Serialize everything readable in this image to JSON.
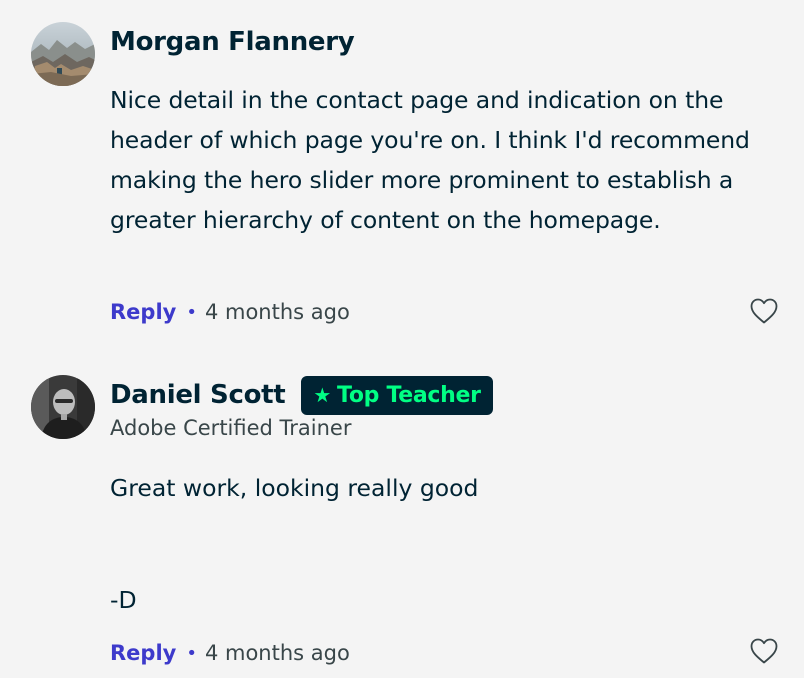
{
  "comments": [
    {
      "author": "Morgan Flannery",
      "badge": null,
      "subtitle": null,
      "text": "Nice detail in the contact page and indication on the header of which page you're on. I think I'd recommend making the hero slider more prominent to establish a greater hierarchy of content on the homepage.",
      "reply_label": "Reply",
      "separator": "•",
      "timestamp": "4 months ago",
      "like_icon": "heart-outline-icon"
    },
    {
      "author": "Daniel Scott",
      "badge": {
        "star": "★",
        "label": "Top Teacher"
      },
      "subtitle": "Adobe Certified Trainer",
      "text_lines": [
        "Great work, looking really good",
        "",
        "",
        "-D"
      ],
      "reply_label": "Reply",
      "separator": "•",
      "timestamp": "4 months ago",
      "like_icon": "heart-outline-icon"
    }
  ],
  "colors": {
    "background": "#f4f4f4",
    "text": "#002333",
    "secondary_text": "#394649",
    "link": "#3d3acb",
    "badge_background": "#002333",
    "badge_text": "#00ff84"
  }
}
